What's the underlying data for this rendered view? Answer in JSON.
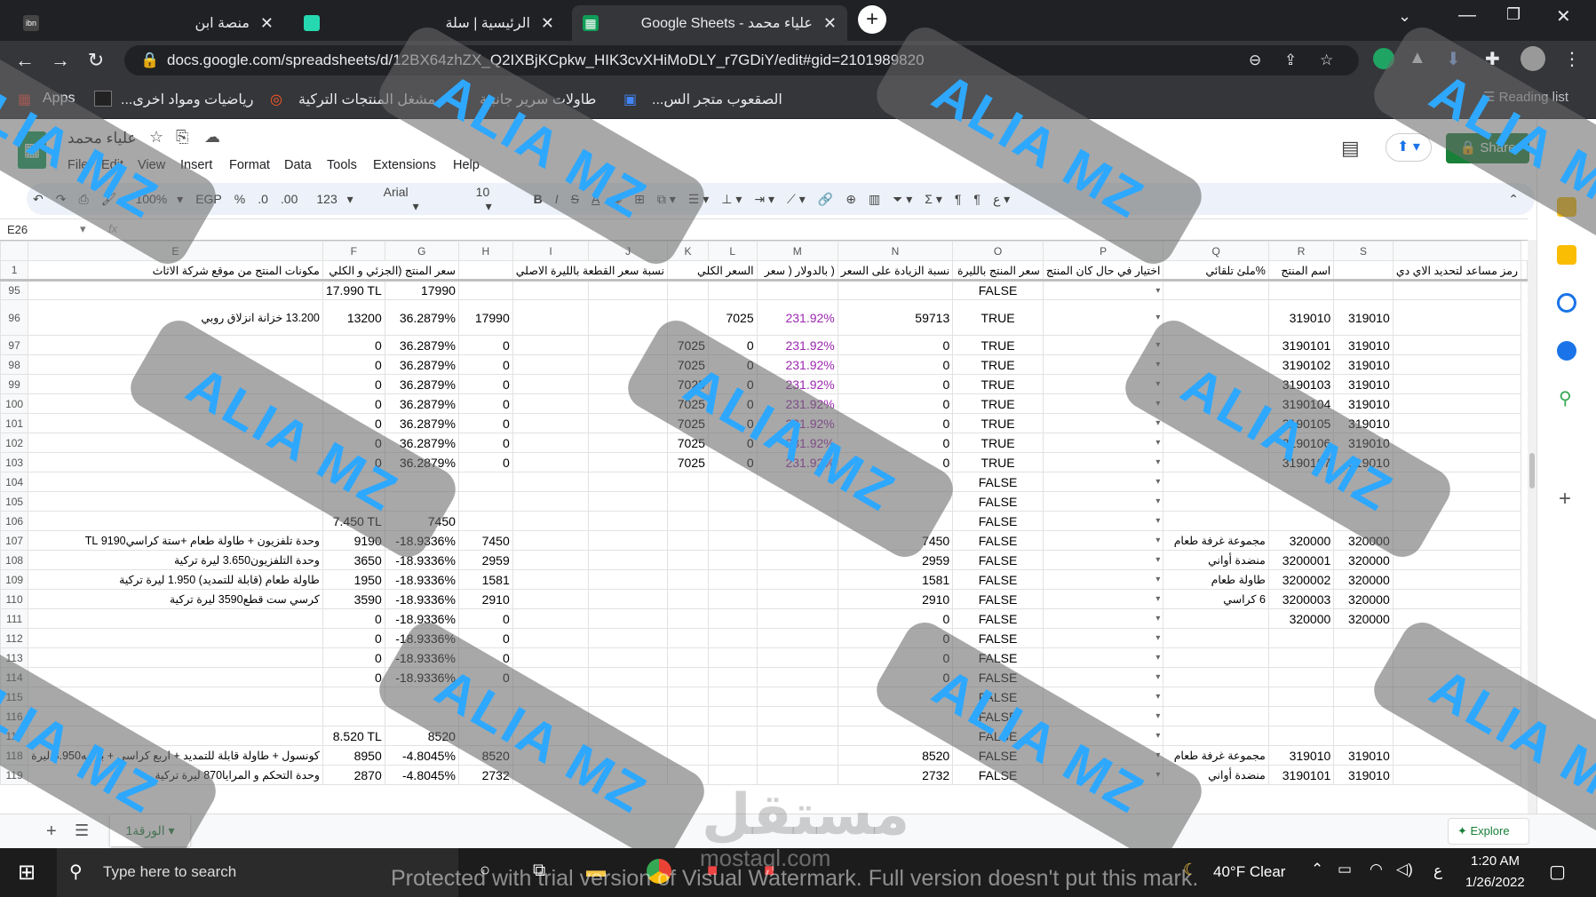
{
  "browser": {
    "tabs": [
      {
        "title": "منصة ابن",
        "active": false
      },
      {
        "title": "الرئيسية | سلة",
        "active": false
      },
      {
        "title": "Google Sheets - علياء محمد",
        "active": true
      }
    ],
    "new_tab": "+",
    "url": "docs.google.com/spreadsheets/d/12BX64zhZX_Q2IXBjKCpkw_HIK3cvXHiMoDLY_r7GDiY/edit#gid=2101989820",
    "bookmarks": [
      "Apps",
      "رياضيات ومواد اخرى...",
      "مشغل المنتجات التركية",
      "طاولات سرير جانبية",
      "الصقعوب متجر الس..."
    ],
    "reading_list": "Reading list"
  },
  "sheets": {
    "doc_title": "علياء محمد",
    "menus": [
      "File",
      "Edit",
      "View",
      "Insert",
      "Format",
      "Data",
      "Tools",
      "Extensions",
      "Help"
    ],
    "share_label": "Share",
    "toolbar": {
      "zoom": "100%",
      "currency": "EGP",
      "percent": "%",
      "dec_less": ".0",
      "dec_more": ".00",
      "number_fmt": "123",
      "font": "Arial",
      "font_size": "10"
    },
    "name_box": "E26",
    "fx": "fx",
    "columns": [
      "E",
      "F",
      "G",
      "H",
      "I",
      "J",
      "K",
      "L",
      "M",
      "N",
      "O",
      "P",
      "Q",
      "R",
      "S"
    ],
    "header_row": {
      "num": "1",
      "E": "مكونات المنتج من موقع شركة الاثاث",
      "F": "سعر المنتج (الجزئي و الكلي",
      "G": "",
      "H": "",
      "I": "نسبة سعر القطعة بالليرة الاصلي",
      "J": "",
      "K": "السعر الكلي",
      "L": "( بالدولار ( سعر",
      "M": "نسبة الزيادة على السعر",
      "N": "سعر المنتج بالليرة",
      "O": "اختيار في حال كان المنتج",
      "P": "%ملئ تلقائي",
      "Q": "اسم المنتج",
      "R": "",
      "S": "رمز مساعد لتحديد الاي دي"
    },
    "rows": [
      {
        "num": "95",
        "E": "",
        "F": "17.990 TL",
        "G": "17990",
        "H": "",
        "K": "",
        "L": "",
        "M": "",
        "N": "",
        "O": "FALSE",
        "Q": "",
        "R": "",
        "S": ""
      },
      {
        "num": "96",
        "E": "13.200 خزانة انزلاق روبي",
        "F": "13200",
        "G": "36.2879%",
        "H": "17990",
        "K": "",
        "L": "7025",
        "M": "231.92%",
        "N": "59713",
        "O": "TRUE",
        "Q": "",
        "R": "319010",
        "S": "319010"
      },
      {
        "num": "97",
        "E": "",
        "F": "0",
        "G": "36.2879%",
        "H": "0",
        "K": "7025",
        "L": "0",
        "M": "231.92%",
        "N": "0",
        "O": "TRUE",
        "Q": "",
        "R": "3190101",
        "S": "319010"
      },
      {
        "num": "98",
        "E": "",
        "F": "0",
        "G": "36.2879%",
        "H": "0",
        "K": "7025",
        "L": "0",
        "M": "231.92%",
        "N": "0",
        "O": "TRUE",
        "Q": "",
        "R": "3190102",
        "S": "319010"
      },
      {
        "num": "99",
        "E": "",
        "F": "0",
        "G": "36.2879%",
        "H": "0",
        "K": "7025",
        "L": "0",
        "M": "231.92%",
        "N": "0",
        "O": "TRUE",
        "Q": "",
        "R": "3190103",
        "S": "319010"
      },
      {
        "num": "100",
        "E": "",
        "F": "0",
        "G": "36.2879%",
        "H": "0",
        "K": "7025",
        "L": "0",
        "M": "231.92%",
        "N": "0",
        "O": "TRUE",
        "Q": "",
        "R": "3190104",
        "S": "319010"
      },
      {
        "num": "101",
        "E": "",
        "F": "0",
        "G": "36.2879%",
        "H": "0",
        "K": "7025",
        "L": "0",
        "M": "231.92%",
        "N": "0",
        "O": "TRUE",
        "Q": "",
        "R": "3190105",
        "S": "319010"
      },
      {
        "num": "102",
        "E": "",
        "F": "0",
        "G": "36.2879%",
        "H": "0",
        "K": "7025",
        "L": "0",
        "M": "231.92%",
        "N": "0",
        "O": "TRUE",
        "Q": "",
        "R": "3190106",
        "S": "319010"
      },
      {
        "num": "103",
        "E": "",
        "F": "0",
        "G": "36.2879%",
        "H": "0",
        "K": "7025",
        "L": "0",
        "M": "231.92%",
        "N": "0",
        "O": "TRUE",
        "Q": "",
        "R": "3190107",
        "S": "319010"
      },
      {
        "num": "104",
        "E": "",
        "F": "",
        "G": "",
        "H": "",
        "K": "",
        "L": "",
        "M": "",
        "N": "",
        "O": "FALSE",
        "Q": "",
        "R": "",
        "S": ""
      },
      {
        "num": "105",
        "E": "",
        "F": "",
        "G": "",
        "H": "",
        "K": "",
        "L": "",
        "M": "",
        "N": "",
        "O": "FALSE",
        "Q": "",
        "R": "",
        "S": ""
      },
      {
        "num": "106",
        "E": "",
        "F": "7.450 TL",
        "G": "7450",
        "H": "",
        "K": "",
        "L": "",
        "M": "",
        "N": "",
        "O": "FALSE",
        "Q": "",
        "R": "",
        "S": ""
      },
      {
        "num": "107",
        "E": "وحدة تلفزيون + طاولة طعام +ستة كراسي9190 TL",
        "F": "9190",
        "G": "-18.9336%",
        "H": "7450",
        "K": "",
        "L": "",
        "M": "",
        "N": "7450",
        "O": "FALSE",
        "Q": "مجموعة غرفة طعام",
        "R": "320000",
        "S": "320000"
      },
      {
        "num": "108",
        "E": "وحدة التلفزيون3.650 ليرة تركية",
        "F": "3650",
        "G": "-18.9336%",
        "H": "2959",
        "K": "",
        "L": "",
        "M": "",
        "N": "2959",
        "O": "FALSE",
        "Q": "منضدة أواني",
        "R": "3200001",
        "S": "320000"
      },
      {
        "num": "109",
        "E": "طاولة طعام (قابلة للتمديد) 1.950 ليرة تركية",
        "F": "1950",
        "G": "-18.9336%",
        "H": "1581",
        "K": "",
        "L": "",
        "M": "",
        "N": "1581",
        "O": "FALSE",
        "Q": "طاولة طعام",
        "R": "3200002",
        "S": "320000"
      },
      {
        "num": "110",
        "E": "كرسي ست قطع3590 ليرة تركية",
        "F": "3590",
        "G": "-18.9336%",
        "H": "2910",
        "K": "",
        "L": "",
        "M": "",
        "N": "2910",
        "O": "FALSE",
        "Q": "6 كراسي",
        "R": "3200003",
        "S": "320000"
      },
      {
        "num": "111",
        "E": "",
        "F": "0",
        "G": "-18.9336%",
        "H": "0",
        "K": "",
        "L": "",
        "M": "",
        "N": "0",
        "O": "FALSE",
        "Q": "",
        "R": "320000",
        "S": "320000"
      },
      {
        "num": "112",
        "E": "",
        "F": "0",
        "G": "-18.9336%",
        "H": "0",
        "K": "",
        "L": "",
        "M": "",
        "N": "0",
        "O": "FALSE",
        "Q": "",
        "R": "",
        "S": ""
      },
      {
        "num": "113",
        "E": "",
        "F": "0",
        "G": "-18.9336%",
        "H": "0",
        "K": "",
        "L": "",
        "M": "",
        "N": "0",
        "O": "FALSE",
        "Q": "",
        "R": "",
        "S": ""
      },
      {
        "num": "114",
        "E": "",
        "F": "0",
        "G": "-18.9336%",
        "H": "0",
        "K": "",
        "L": "",
        "M": "",
        "N": "0",
        "O": "FALSE",
        "Q": "",
        "R": "",
        "S": ""
      },
      {
        "num": "115",
        "E": "",
        "F": "",
        "G": "",
        "H": "",
        "K": "",
        "L": "",
        "M": "",
        "N": "",
        "O": "FALSE",
        "Q": "",
        "R": "",
        "S": ""
      },
      {
        "num": "116",
        "E": "",
        "F": "",
        "G": "",
        "H": "",
        "K": "",
        "L": "",
        "M": "",
        "N": "",
        "O": "FALSE",
        "Q": "",
        "R": "",
        "S": ""
      },
      {
        "num": "117",
        "E": "",
        "F": "8.520 TL",
        "G": "8520",
        "H": "",
        "K": "",
        "L": "",
        "M": "",
        "N": "",
        "O": "FALSE",
        "Q": "",
        "R": "",
        "S": ""
      },
      {
        "num": "118",
        "E": "كونسول + طاولة قابلة للتمديد + اربع كراسي + بوفيه8.950 ليرة",
        "F": "8950",
        "G": "-4.8045%",
        "H": "8520",
        "K": "",
        "L": "",
        "M": "",
        "N": "8520",
        "O": "FALSE",
        "Q": "مجموعة غرفة طعام",
        "R": "319010",
        "S": "319010"
      },
      {
        "num": "119",
        "E": "وحدة التحكم و المرايا870 ليرة تركية",
        "F": "2870",
        "G": "-4.8045%",
        "H": "2732",
        "K": "",
        "L": "",
        "M": "",
        "N": "2732",
        "O": "FALSE",
        "Q": "منضدة أواني",
        "R": "3190101",
        "S": "319010"
      }
    ],
    "sheet_tab": "الورقة1",
    "explore_label": "Explore"
  },
  "watermark": {
    "text": "ALIA MZ",
    "color": "#2ea8ff"
  },
  "overlay_text": {
    "mostaql_ar": "مستقل",
    "mostaql_en": "mostaql.com",
    "protected": "Protected with trial version of Visual Watermark. Full version doesn't put this mark."
  },
  "taskbar": {
    "search_placeholder": "Type here to search",
    "weather": "40°F  Clear",
    "time": "1:20 AM",
    "date": "1/26/2022",
    "lang": "ع"
  }
}
